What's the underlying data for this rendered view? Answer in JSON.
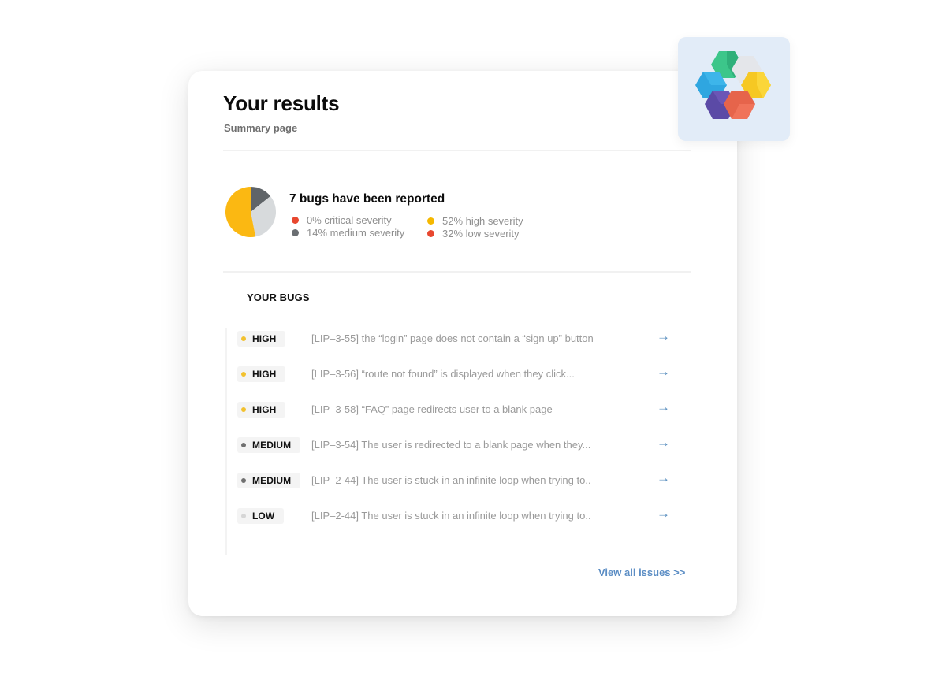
{
  "header": {
    "title": "Your results",
    "subtitle": "Summary page"
  },
  "summary": {
    "title": "7 bugs have been reported",
    "legend": [
      {
        "label": "0% critical severity",
        "color": "#e8472f"
      },
      {
        "label": "14% medium severity",
        "color": "#6a6e72"
      },
      {
        "label": "52% high severity",
        "color": "#f5b800"
      },
      {
        "label": "32% low severity",
        "color": "#e8472f"
      }
    ]
  },
  "chart_data": {
    "type": "pie",
    "title": "7 bugs have been reported",
    "slices": [
      {
        "name": "critical",
        "value": 0,
        "color": "#e8472f"
      },
      {
        "name": "medium",
        "value": 14,
        "color": "#5f6468"
      },
      {
        "name": "low",
        "value": 32,
        "color": "#d7dadc"
      },
      {
        "name": "high",
        "value": 52,
        "color": "#fbb812"
      }
    ]
  },
  "bugs_section": {
    "title": "YOUR BUGS",
    "items": [
      {
        "severity": "HIGH",
        "dot_color": "#f2c12e",
        "text": "[LIP–3-55] the “login” page does not contain a “sign up” button",
        "arrow": "→"
      },
      {
        "severity": "HIGH",
        "dot_color": "#f2c12e",
        "text": "[LIP–3-56] “route not found” is displayed when they click...",
        "arrow": "→"
      },
      {
        "severity": "HIGH",
        "dot_color": "#f2c12e",
        "text": "[LIP–3-58] “FAQ” page redirects user to a blank page",
        "arrow": "→"
      },
      {
        "severity": "MEDIUM",
        "dot_color": "#707070",
        "text": "[LIP–3-54] The user is redirected to a blank page when they...",
        "arrow": "→"
      },
      {
        "severity": "MEDIUM",
        "dot_color": "#707070",
        "text": "[LIP–2-44] The user is stuck in an infinite loop when trying to..",
        "arrow": "→"
      },
      {
        "severity": "LOW",
        "dot_color": "#d6d6d6",
        "text": "[LIP–2-44] The user is stuck in an infinite loop when trying to..",
        "arrow": "→"
      }
    ]
  },
  "footer": {
    "view_all_label": "View all issues >>"
  },
  "logo": {
    "icon": "hexagon-cubes-logo"
  }
}
